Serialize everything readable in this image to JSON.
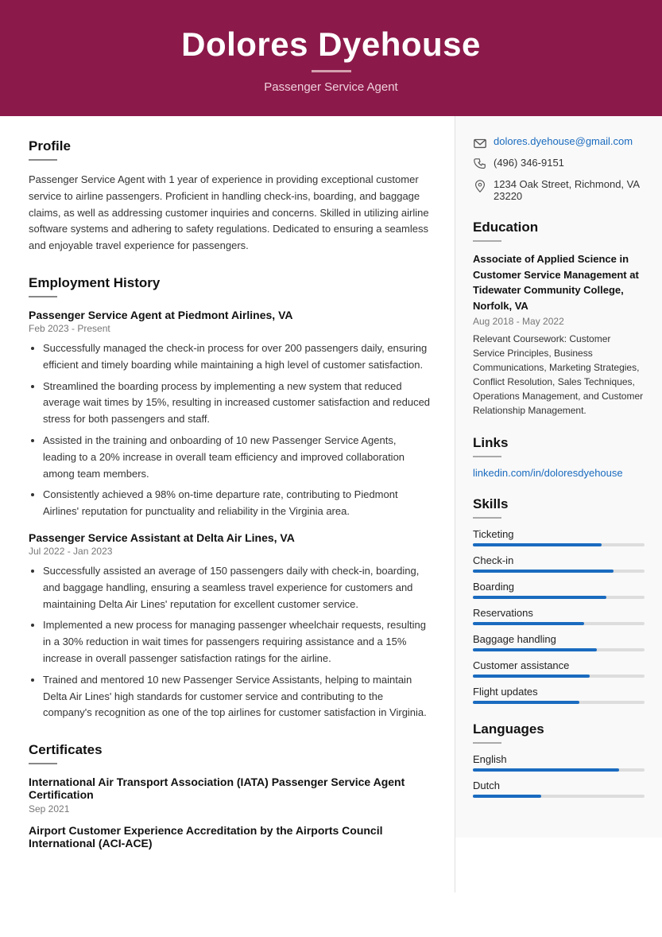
{
  "header": {
    "name": "Dolores Dyehouse",
    "subtitle": "Passenger Service Agent",
    "divider_color": "#d4a0b0"
  },
  "profile": {
    "title": "Profile",
    "text": "Passenger Service Agent with 1 year of experience in providing exceptional customer service to airline passengers. Proficient in handling check-ins, boarding, and baggage claims, as well as addressing customer inquiries and concerns. Skilled in utilizing airline software systems and adhering to safety regulations. Dedicated to ensuring a seamless and enjoyable travel experience for passengers."
  },
  "employment": {
    "title": "Employment History",
    "jobs": [
      {
        "title": "Passenger Service Agent at Piedmont Airlines, VA",
        "date": "Feb 2023 - Present",
        "bullets": [
          "Successfully managed the check-in process for over 200 passengers daily, ensuring efficient and timely boarding while maintaining a high level of customer satisfaction.",
          "Streamlined the boarding process by implementing a new system that reduced average wait times by 15%, resulting in increased customer satisfaction and reduced stress for both passengers and staff.",
          "Assisted in the training and onboarding of 10 new Passenger Service Agents, leading to a 20% increase in overall team efficiency and improved collaboration among team members.",
          "Consistently achieved a 98% on-time departure rate, contributing to Piedmont Airlines' reputation for punctuality and reliability in the Virginia area."
        ]
      },
      {
        "title": "Passenger Service Assistant at Delta Air Lines, VA",
        "date": "Jul 2022 - Jan 2023",
        "bullets": [
          "Successfully assisted an average of 150 passengers daily with check-in, boarding, and baggage handling, ensuring a seamless travel experience for customers and maintaining Delta Air Lines' reputation for excellent customer service.",
          "Implemented a new process for managing passenger wheelchair requests, resulting in a 30% reduction in wait times for passengers requiring assistance and a 15% increase in overall passenger satisfaction ratings for the airline.",
          "Trained and mentored 10 new Passenger Service Assistants, helping to maintain Delta Air Lines' high standards for customer service and contributing to the company's recognition as one of the top airlines for customer satisfaction in Virginia."
        ]
      }
    ]
  },
  "certificates": {
    "title": "Certificates",
    "items": [
      {
        "title": "International Air Transport Association (IATA) Passenger Service Agent Certification",
        "date": "Sep 2021"
      },
      {
        "title": "Airport Customer Experience Accreditation by the Airports Council International (ACI-ACE)",
        "date": ""
      }
    ]
  },
  "contact": {
    "email": "dolores.dyehouse@gmail.com",
    "phone": "(496) 346-9151",
    "address": "1234 Oak Street, Richmond, VA 23220"
  },
  "education": {
    "title": "Education",
    "degree": "Associate of Applied Science in Customer Service Management at Tidewater Community College, Norfolk, VA",
    "date": "Aug 2018 - May 2022",
    "coursework": "Relevant Coursework: Customer Service Principles, Business Communications, Marketing Strategies, Conflict Resolution, Sales Techniques, Operations Management, and Customer Relationship Management."
  },
  "links": {
    "title": "Links",
    "url": "linkedin.com/in/doloresdyehouse"
  },
  "skills": {
    "title": "Skills",
    "items": [
      {
        "name": "Ticketing",
        "percent": 75
      },
      {
        "name": "Check-in",
        "percent": 82
      },
      {
        "name": "Boarding",
        "percent": 78
      },
      {
        "name": "Reservations",
        "percent": 65
      },
      {
        "name": "Baggage handling",
        "percent": 72
      },
      {
        "name": "Customer assistance",
        "percent": 68
      },
      {
        "name": "Flight updates",
        "percent": 62
      }
    ]
  },
  "languages": {
    "title": "Languages",
    "items": [
      {
        "name": "English",
        "percent": 85
      },
      {
        "name": "Dutch",
        "percent": 40
      }
    ]
  }
}
